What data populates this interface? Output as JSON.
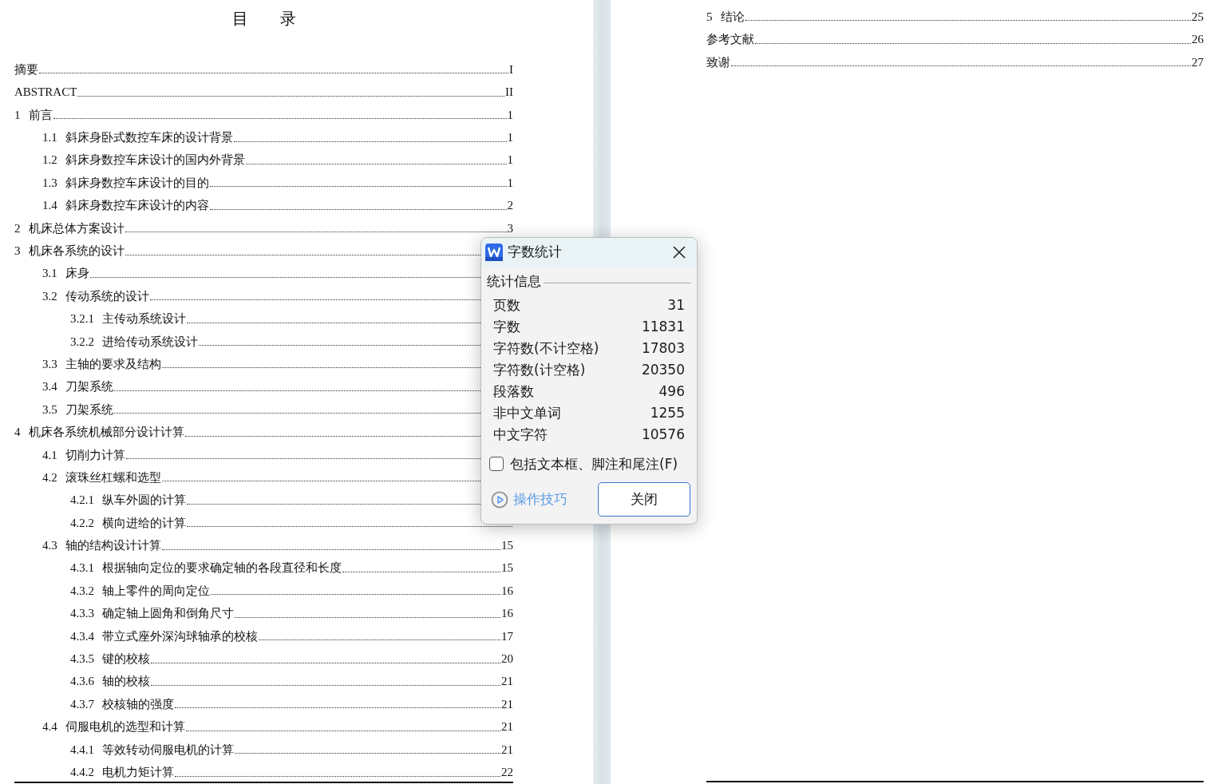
{
  "left_page": {
    "title": "目　　录",
    "toc": [
      {
        "title": "摘要",
        "page": "I"
      },
      {
        "title": "ABSTRACT",
        "page": "II"
      },
      {
        "number": "1",
        "title": "前言",
        "page": "1",
        "children": [
          {
            "number": "1.1",
            "title": "斜床身卧式数控车床的设计背景",
            "page": "1"
          },
          {
            "number": "1.2",
            "title": "斜床身数控车床设计的国内外背景",
            "page": "1"
          },
          {
            "number": "1.3",
            "title": "斜床身数控车床设计的目的",
            "page": "1"
          },
          {
            "number": "1.4",
            "title": "斜床身数控车床设计的内容",
            "page": "2"
          }
        ]
      },
      {
        "number": "2",
        "title": "机床总体方案设计",
        "page": "3"
      },
      {
        "number": "3",
        "title": "机床各系统的设计",
        "children": [
          {
            "number": "3.1",
            "title": "床身"
          },
          {
            "number": "3.2",
            "title": "传动系统的设计",
            "children": [
              {
                "number": "3.2.1",
                "title": "主传动系统设计"
              },
              {
                "number": "3.2.2",
                "title": "进给传动系统设计"
              }
            ]
          },
          {
            "number": "3.3",
            "title": "主轴的要求及结构"
          },
          {
            "number": "3.4",
            "title": "刀架系统"
          },
          {
            "number": "3.5",
            "title": "刀架系统"
          }
        ]
      },
      {
        "number": "4",
        "title": "机床各系统机械部分设计计算",
        "children": [
          {
            "number": "4.1",
            "title": "切削力计算"
          },
          {
            "number": "4.2",
            "title": "滚珠丝杠螺和选型",
            "children": [
              {
                "number": "4.2.1",
                "title": "纵车外圆的计算"
              },
              {
                "number": "4.2.2",
                "title": "横向进给的计算"
              }
            ]
          },
          {
            "number": "4.3",
            "title": "轴的结构设计计算",
            "page": "15",
            "children": [
              {
                "number": "4.3.1",
                "title": "根据轴向定位的要求确定轴的各段直径和长度",
                "page": "15"
              },
              {
                "number": "4.3.2",
                "title": "轴上零件的周向定位",
                "page": "16"
              },
              {
                "number": "4.3.3",
                "title": "确定轴上圆角和倒角尺寸",
                "page": "16"
              },
              {
                "number": "4.3.4",
                "title": "带立式座外深沟球轴承的校核",
                "page": "17"
              },
              {
                "number": "4.3.5",
                "title": "键的校核",
                "page": "20"
              },
              {
                "number": "4.3.6",
                "title": "轴的校核",
                "page": "21"
              },
              {
                "number": "4.3.7",
                "title": "校核轴的强度",
                "page": "21"
              }
            ]
          },
          {
            "number": "4.4",
            "title": "伺服电机的选型和计算",
            "page": "21",
            "children": [
              {
                "number": "4.4.1",
                "title": "等效转动伺服电机的计算",
                "page": "21"
              },
              {
                "number": "4.4.2",
                "title": "电机力矩计算",
                "page": "22"
              }
            ]
          }
        ]
      }
    ]
  },
  "right_page": {
    "toc": [
      {
        "number": "5",
        "title": "结论",
        "page": "25"
      },
      {
        "title": "参考文献",
        "page": "26"
      },
      {
        "title": "致谢",
        "page": "27"
      }
    ]
  },
  "dialog": {
    "title": "字数统计",
    "section": "统计信息",
    "stats": [
      {
        "label": "页数",
        "value": "31"
      },
      {
        "label": "字数",
        "value": "11831"
      },
      {
        "label": "字符数(不计空格)",
        "value": "17803"
      },
      {
        "label": "字符数(计空格)",
        "value": "20350"
      },
      {
        "label": "段落数",
        "value": "496"
      },
      {
        "label": "非中文单词",
        "value": "1255"
      },
      {
        "label": "中文字符",
        "value": "10576"
      }
    ],
    "option": {
      "label": "包括文本框、脚注和尾注(F)",
      "checked": false
    },
    "tips_link": "操作技巧",
    "close_button": "关闭"
  }
}
